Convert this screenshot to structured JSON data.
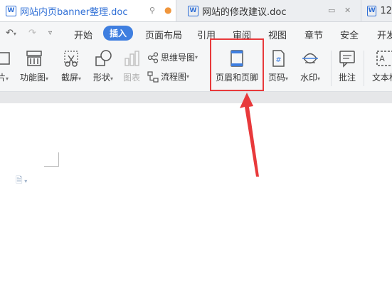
{
  "tabs": [
    {
      "title": "网站内页banner整理.doc",
      "icon": "wps-writer-icon"
    },
    {
      "title": "网站的修改建议.doc",
      "icon": "wps-writer-icon"
    },
    {
      "title": "12",
      "icon": "wps-writer-icon"
    }
  ],
  "menu": {
    "items": [
      "开始",
      "插入",
      "页面布局",
      "引用",
      "审阅",
      "视图",
      "章节",
      "安全",
      "开发"
    ],
    "active": "插入"
  },
  "ribbon": {
    "picture_partial": "片",
    "function_chart": "功能图",
    "screenshot": "截屏",
    "shapes": "形状",
    "chart": "图表",
    "mindmap": "思维导图",
    "flowchart": "流程图",
    "header_footer": "页眉和页脚",
    "page_number": "页码",
    "watermark": "水印",
    "comment": "批注",
    "textbox": "文本框"
  },
  "colors": {
    "accent": "#3f7fe0",
    "highlight": "#e8393b",
    "tab_modified_dot": "#f0963c"
  }
}
